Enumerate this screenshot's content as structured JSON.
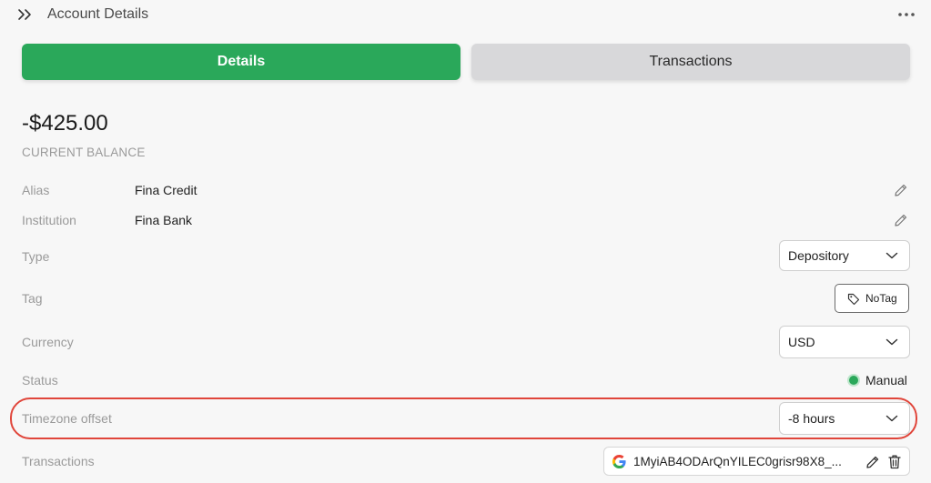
{
  "header": {
    "title": "Account Details"
  },
  "tabs": [
    {
      "label": "Details",
      "active": true
    },
    {
      "label": "Transactions",
      "active": false
    }
  ],
  "balance": {
    "amount": "-$425.00",
    "label": "CURRENT BALANCE"
  },
  "fields": {
    "alias": {
      "label": "Alias",
      "value": "Fina Credit"
    },
    "institution": {
      "label": "Institution",
      "value": "Fina Bank"
    },
    "type": {
      "label": "Type",
      "value": "Depository"
    },
    "tag": {
      "label": "Tag",
      "button": "NoTag"
    },
    "currency": {
      "label": "Currency",
      "value": "USD"
    },
    "status": {
      "label": "Status",
      "value": "Manual"
    },
    "timezone": {
      "label": "Timezone offset",
      "value": "-8 hours"
    },
    "transactions": {
      "label": "Transactions",
      "value": "1MyiAB4ODArQnYILEC0grisr98X8_..."
    }
  },
  "colors": {
    "accent": "#2aa85a",
    "highlight": "#e0453a",
    "status_dot": "#2aa85a"
  },
  "icons": [
    "double-chevron-right-icon",
    "more-dots-icon",
    "pencil-icon",
    "chevron-down-icon",
    "tag-icon",
    "google-icon",
    "trash-icon"
  ]
}
